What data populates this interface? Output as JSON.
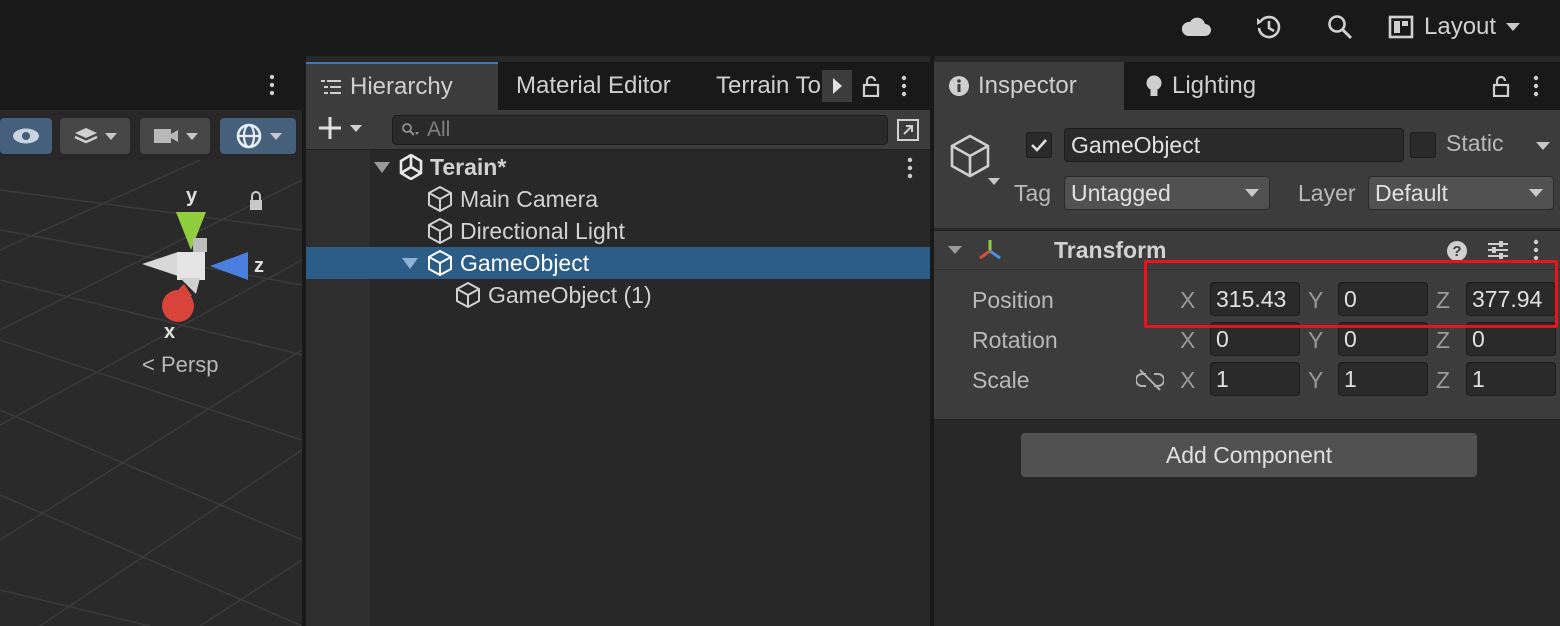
{
  "topbar": {
    "layout_label": "Layout",
    "icons": [
      "cloud-icon",
      "history-icon",
      "search-icon",
      "layout-icon"
    ]
  },
  "scene": {
    "persp_label": "< Persp",
    "gizmo": {
      "x_label": "x",
      "y_label": "y",
      "z_label": "z"
    }
  },
  "hierarchy": {
    "tabs": [
      {
        "label": "Hierarchy",
        "active": true
      },
      {
        "label": "Material Editor",
        "active": false
      },
      {
        "label": "Terrain To",
        "active": false
      }
    ],
    "search_placeholder": "All",
    "tree": [
      {
        "label": "Terain*",
        "depth": 0,
        "expanded": true,
        "selected": false,
        "is_scene": true
      },
      {
        "label": "Main Camera",
        "depth": 1,
        "expanded": false,
        "selected": false
      },
      {
        "label": "Directional Light",
        "depth": 1,
        "expanded": false,
        "selected": false
      },
      {
        "label": "GameObject",
        "depth": 1,
        "expanded": true,
        "selected": true
      },
      {
        "label": "GameObject (1)",
        "depth": 2,
        "expanded": false,
        "selected": false
      }
    ]
  },
  "inspector": {
    "tabs": [
      {
        "label": "Inspector",
        "active": true
      },
      {
        "label": "Lighting",
        "active": false
      }
    ],
    "object_name": "GameObject",
    "static_label": "Static",
    "tag_label": "Tag",
    "tag_value": "Untagged",
    "layer_label": "Layer",
    "layer_value": "Default",
    "transform": {
      "title": "Transform",
      "position": {
        "label": "Position",
        "x": "315.43",
        "y": "0",
        "z": "377.94"
      },
      "rotation": {
        "label": "Rotation",
        "x": "0",
        "y": "0",
        "z": "0"
      },
      "scale": {
        "label": "Scale",
        "x": "1",
        "y": "1",
        "z": "1"
      },
      "axes": {
        "x": "X",
        "y": "Y",
        "z": "Z"
      }
    },
    "add_component_label": "Add Component"
  },
  "colors": {
    "highlight": "#e8141b",
    "selection": "#2c5d87",
    "active_tab_accent": "#3a79bb"
  }
}
